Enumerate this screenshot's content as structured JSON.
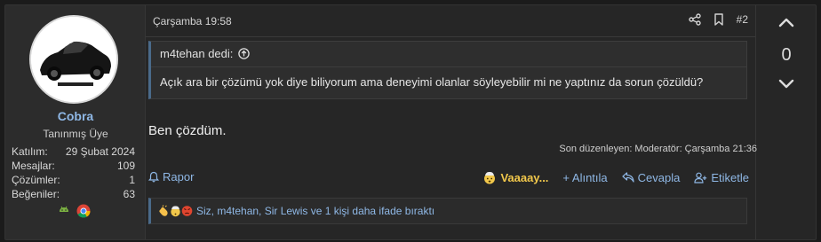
{
  "post": {
    "date": "Çarşamba 19:58",
    "number": "#2",
    "message": "Ben çözdüm.",
    "edited": "Son düzenleyen: Moderatör: Çarşamba 21:36"
  },
  "user": {
    "name": "Cobra",
    "title": "Tanınmış Üye",
    "stats": [
      {
        "label": "Katılım:",
        "value": "29 Şubat 2024"
      },
      {
        "label": "Mesajlar:",
        "value": "109"
      },
      {
        "label": "Çözümler:",
        "value": "1"
      },
      {
        "label": "Beğeniler:",
        "value": "63"
      }
    ]
  },
  "quote": {
    "author": "m4tehan dedi:",
    "text": "Açık ara bir çözümü yok diye biliyorum ama deneyimi olanlar söyleyebilir mi ne yaptınız da sorun çözüldü?"
  },
  "actions": {
    "report": "Rapor",
    "reaction": "Vaaaay...",
    "quote": "+ Alıntıla",
    "reply": "Cevapla",
    "tag": "Etiketle"
  },
  "reactions": {
    "text": "Siz, m4tehan, Sir Lewis ve 1 kişi daha ifade bıraktı"
  },
  "vote": {
    "count": "0"
  },
  "colors": {
    "accent": "#8fb8e6",
    "reaction": "#f2c84b"
  }
}
